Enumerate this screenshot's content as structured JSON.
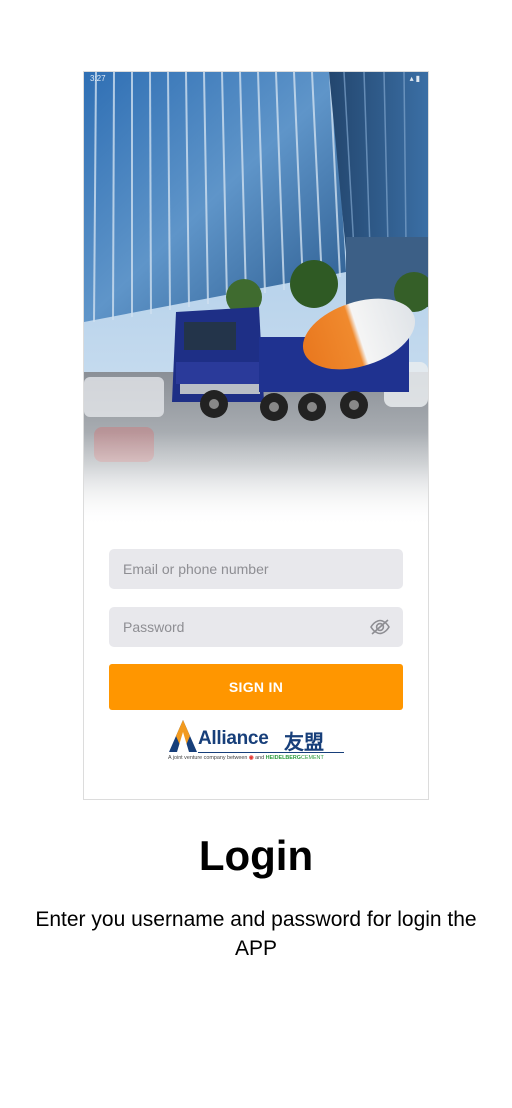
{
  "screen": {
    "title": "Login",
    "subtitle": "Enter you username and password for login the APP"
  },
  "status_bar": {
    "time": "3:27"
  },
  "login_form": {
    "email_placeholder": "Email or phone number",
    "password_placeholder": "Password",
    "password_toggle_icon": "eye-slash-icon",
    "sign_in_label": "SIGN IN",
    "sign_in_color": "#ff9600"
  },
  "logo": {
    "name": "Alliance",
    "chinese_name": "友盟",
    "tagline_prefix": "A joint venture company between",
    "tagline_and": "and",
    "tagline_partner_a": "HEIDELBERG",
    "tagline_partner_b": "CEMENT",
    "brand_color": "#173f7a"
  }
}
